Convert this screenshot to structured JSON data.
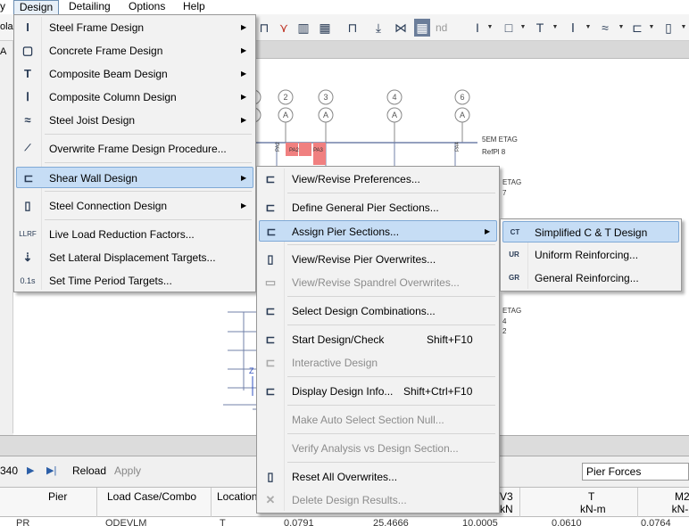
{
  "menubar": {
    "frag_left": "y",
    "design": "Design",
    "detailing": "Detailing",
    "options": "Options",
    "help": "Help"
  },
  "left_strip": {
    "frag1": "ola",
    "frag2": "A"
  },
  "toolbar": {
    "nd_label": "nd"
  },
  "canvas": {
    "grid_labels": [
      "2",
      "3",
      "4",
      "6"
    ],
    "grid_letters": [
      "A",
      "A",
      "A",
      "A"
    ],
    "story_labels": [
      "5EM ETAG",
      "RefPl 8"
    ],
    "side_frags": [
      "ETAG",
      "7",
      "ETAG",
      "4",
      "2",
      "ETAG"
    ],
    "pier_labels": [
      "PA2",
      "PA2",
      "PA3",
      "PA4"
    ]
  },
  "design_menu": {
    "items": [
      {
        "label": "Steel Frame Design",
        "icon": "steel-frame-icon",
        "submenu": true
      },
      {
        "label": "Concrete Frame Design",
        "icon": "concrete-frame-icon",
        "submenu": true
      },
      {
        "label": "Composite Beam Design",
        "icon": "composite-beam-icon",
        "submenu": true
      },
      {
        "label": "Composite Column Design",
        "icon": "composite-column-icon",
        "submenu": true
      },
      {
        "label": "Steel Joist Design",
        "icon": "steel-joist-icon",
        "submenu": true
      },
      {
        "label": "Overwrite Frame Design Procedure...",
        "icon": "overwrite-procedure-icon",
        "submenu": false
      },
      {
        "label": "Shear Wall Design",
        "icon": "shear-wall-icon",
        "submenu": true
      },
      {
        "label": "Steel Connection Design",
        "icon": "steel-connection-icon",
        "submenu": true
      },
      {
        "label": "Live Load Reduction Factors...",
        "icon": "llrf-icon",
        "icon_text": "LLRF",
        "submenu": false
      },
      {
        "label": "Set Lateral Displacement Targets...",
        "icon": "lateral-displacement-icon",
        "submenu": false
      },
      {
        "label": "Set Time Period Targets...",
        "icon": "time-period-icon",
        "icon_text": "0.1s",
        "submenu": false
      }
    ]
  },
  "shear_wall_menu": {
    "items": [
      {
        "label": "View/Revise Preferences...",
        "shortcut": "",
        "enabled": true
      },
      {
        "label": "Define General Pier Sections...",
        "shortcut": "",
        "enabled": true
      },
      {
        "label": "Assign Pier Sections...",
        "shortcut": "",
        "enabled": true,
        "submenu": true
      },
      {
        "label": "View/Revise Pier Overwrites...",
        "shortcut": "",
        "enabled": true
      },
      {
        "label": "View/Revise Spandrel Overwrites...",
        "shortcut": "",
        "enabled": false
      },
      {
        "label": "Select Design Combinations...",
        "shortcut": "",
        "enabled": true
      },
      {
        "label": "Start Design/Check",
        "shortcut": "Shift+F10",
        "enabled": true
      },
      {
        "label": "Interactive Design",
        "shortcut": "",
        "enabled": false
      },
      {
        "label": "Display Design Info...",
        "shortcut": "Shift+Ctrl+F10",
        "enabled": true
      },
      {
        "label": "Make Auto Select Section Null...",
        "shortcut": "",
        "enabled": false
      },
      {
        "label": "Verify Analysis vs Design Section...",
        "shortcut": "",
        "enabled": false
      },
      {
        "label": "Reset All Overwrites...",
        "shortcut": "",
        "enabled": true
      },
      {
        "label": "Delete Design Results...",
        "shortcut": "",
        "enabled": false
      }
    ]
  },
  "assign_pier_menu": {
    "items": [
      {
        "label": "Simplified C & T Design",
        "icon_text": "CT"
      },
      {
        "label": "Uniform Reinforcing...",
        "icon_text": "UR"
      },
      {
        "label": "General Reinforcing...",
        "icon_text": "GR"
      }
    ]
  },
  "navbar": {
    "num": "340",
    "reload": "Reload",
    "apply": "Apply",
    "results_select": "Pier Forces"
  },
  "table": {
    "headers": [
      {
        "label": "Pier",
        "sub": ""
      },
      {
        "label": "Load Case/Combo",
        "sub": ""
      },
      {
        "label": "Location",
        "sub": ""
      },
      {
        "label": "V3",
        "sub": "kN"
      },
      {
        "label": "T",
        "sub": "kN-m"
      },
      {
        "label": "M2",
        "sub": "kN-m"
      }
    ],
    "row_frags": [
      "PR",
      "ODEVLM",
      "T",
      "0.0791",
      "25.4666",
      "10.0005",
      "0.0610",
      "0.0764"
    ]
  },
  "colors": {
    "highlight": "#c6ddf5",
    "pier_fill": "#f08080",
    "grid_line": "#7080a8"
  }
}
